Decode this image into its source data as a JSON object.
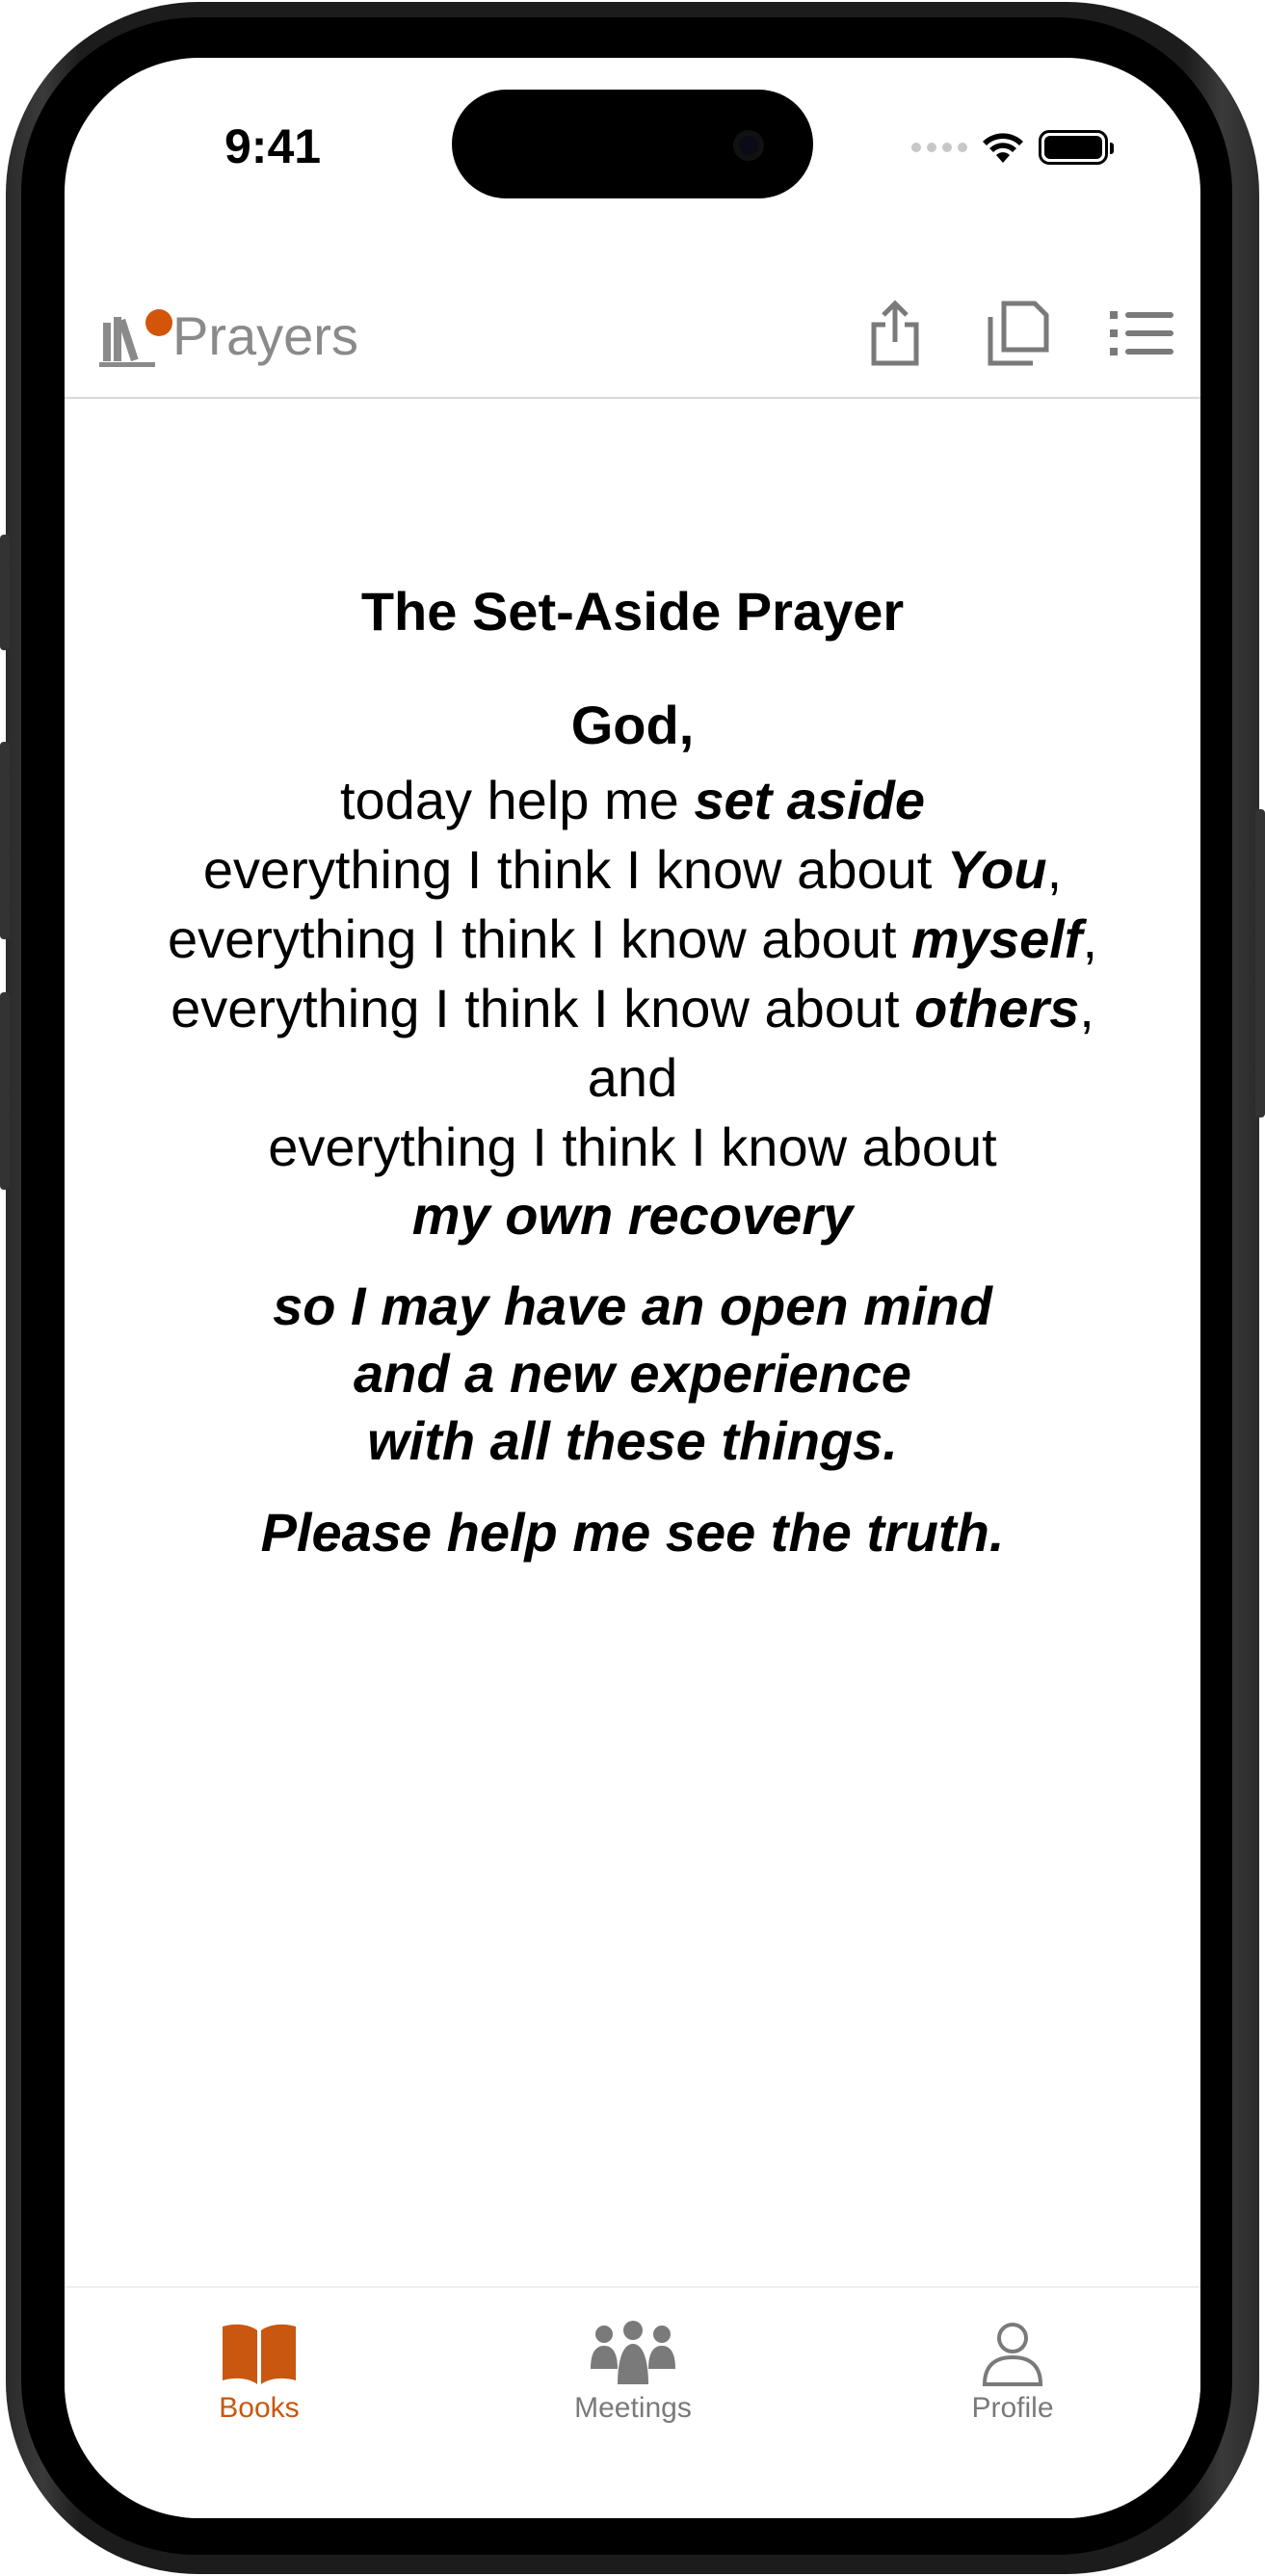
{
  "status_bar": {
    "time": "9:41"
  },
  "nav": {
    "title": "Prayers"
  },
  "prayer": {
    "title": "The Set-Aside Prayer",
    "salutation": "God,",
    "lines": [
      {
        "plain": "today help me ",
        "emphasis": "set aside",
        "tail": ""
      },
      {
        "plain": "everything I think I know about ",
        "emphasis": "You",
        "tail": ","
      },
      {
        "plain": "everything I think I know about ",
        "emphasis": "myself",
        "tail": ","
      },
      {
        "plain": "everything I think I know about ",
        "emphasis": "others",
        "tail": ","
      },
      {
        "plain": "and",
        "emphasis": "",
        "tail": ""
      },
      {
        "plain": "everything I think I know about",
        "emphasis": "",
        "tail": ""
      },
      {
        "plain": "",
        "emphasis": "my own recovery",
        "tail": ""
      }
    ],
    "closing": [
      "so I may have an open mind",
      "and a new experience",
      "with all these things."
    ],
    "final": "Please help me see the truth."
  },
  "tabs": [
    {
      "label": "Books",
      "icon": "open-book-icon",
      "active": true,
      "color": "#c9570f"
    },
    {
      "label": "Meetings",
      "icon": "group-icon",
      "active": false,
      "color": "#7a7a7a"
    },
    {
      "label": "Profile",
      "icon": "person-icon",
      "active": false,
      "color": "#7a7a7a"
    }
  ],
  "colors": {
    "accent": "#c9570f",
    "badge": "#d2550a",
    "muted": "#8a8a8a"
  }
}
